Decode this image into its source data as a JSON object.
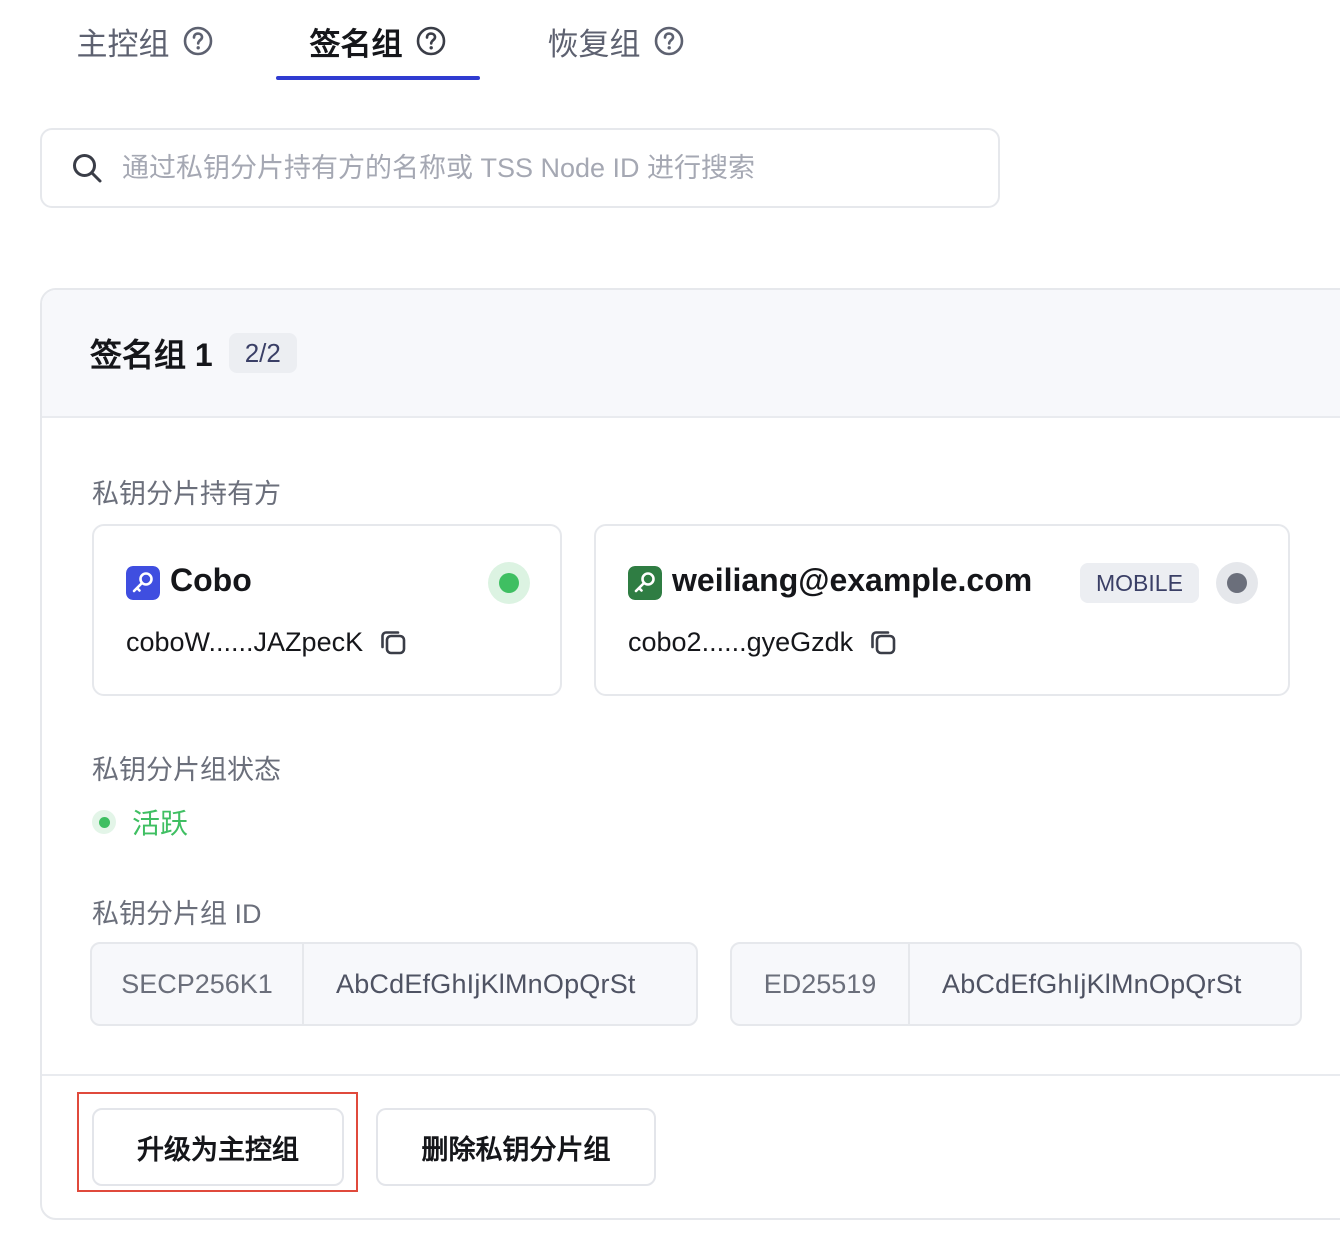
{
  "tabs": [
    {
      "label": "主控组",
      "active": false,
      "icon": "question-circle-icon"
    },
    {
      "label": "签名组",
      "active": true,
      "icon": "question-circle-icon"
    },
    {
      "label": "恢复组",
      "active": false,
      "icon": "question-circle-icon"
    }
  ],
  "search": {
    "placeholder": "通过私钥分片持有方的名称或 TSS Node ID 进行搜索",
    "value": "",
    "icon": "search-icon"
  },
  "group": {
    "title": "签名组 1",
    "count": "2/2",
    "holders_label": "私钥分片持有方",
    "holders": [
      {
        "name": "Cobo",
        "node_id": "coboW......JAZpecK",
        "tag": "",
        "key_icon_color": "#3f4ee0",
        "status_color": "#3fbf62",
        "status_halo": "#dcf3e2"
      },
      {
        "name": "weiliang@example.com",
        "node_id": "cobo2......gyeGzdk",
        "tag": "MOBILE",
        "key_icon_color": "#2f7d43",
        "status_color": "#6b6f7b",
        "status_halo": "#e5e7eb"
      }
    ],
    "status_label": "私钥分片组状态",
    "status_text": "活跃",
    "status_color": "#3fbf62",
    "group_id_label": "私钥分片组 ID",
    "group_ids": [
      {
        "curve": "SECP256K1",
        "value": "AbCdEfGhIjKlMnOpQrSt"
      },
      {
        "curve": "ED25519",
        "value": "AbCdEfGhIjKlMnOpQrSt"
      }
    ],
    "actions": {
      "upgrade_label": "升级为主控组",
      "delete_label": "删除私钥分片组"
    }
  },
  "colors": {
    "accent": "#2f3bd1",
    "highlight": "#e04a3c"
  }
}
